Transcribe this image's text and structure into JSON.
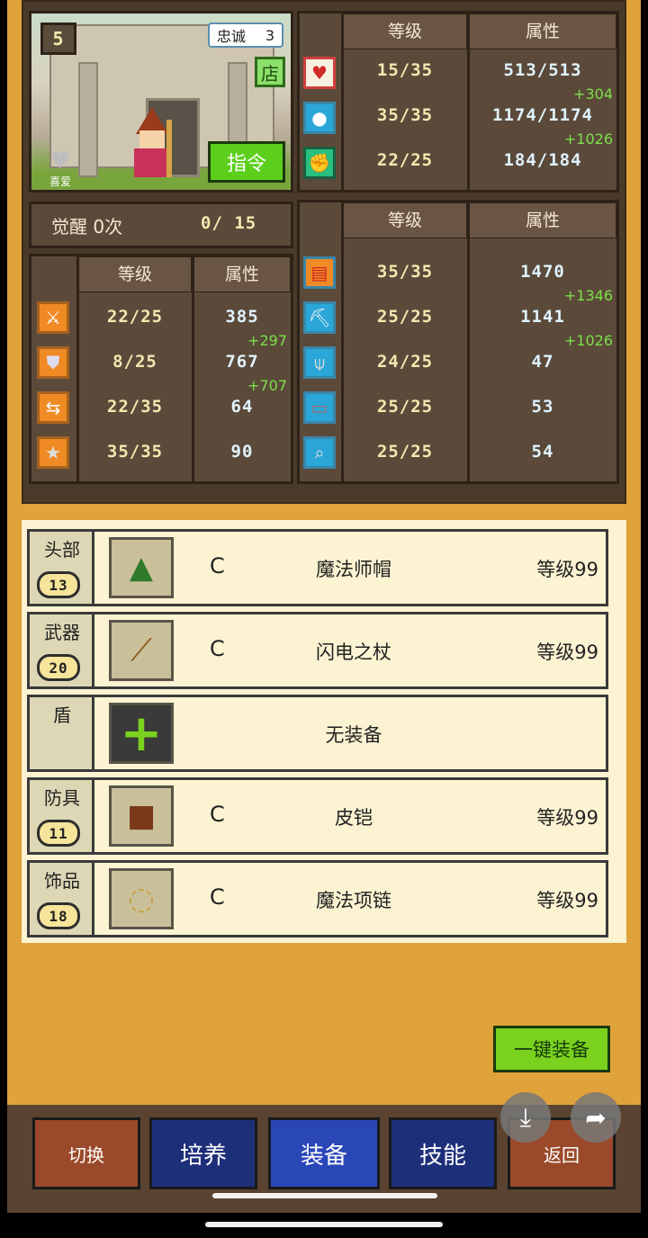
{
  "portrait": {
    "rank_badge": "5",
    "loyalty_label": "忠诚",
    "loyalty_value": "3",
    "shop_label": "店",
    "command_label": "指令",
    "favorite_label": "喜爱"
  },
  "awaken": {
    "label": "觉醒 0次",
    "progress": "0/  15"
  },
  "top_stats": {
    "header_level": "等级",
    "header_attr": "属性",
    "rows": [
      {
        "icon": "heart-icon",
        "level": "15/35",
        "attr": "513/513",
        "bonus": "+304"
      },
      {
        "icon": "mana-potion-icon",
        "level": "35/35",
        "attr": "1174/1174",
        "bonus": "+1026"
      },
      {
        "icon": "strength-arm-icon",
        "level": "22/25",
        "attr": "184/184",
        "bonus": ""
      }
    ]
  },
  "left_stats": {
    "header_level": "等级",
    "header_attr": "属性",
    "rows": [
      {
        "icon": "sword-icon",
        "level": "22/25",
        "attr": "385",
        "bonus": "+297"
      },
      {
        "icon": "shield-icon",
        "level": "8/25",
        "attr": "767",
        "bonus": "+707"
      },
      {
        "icon": "agility-icon",
        "level": "22/35",
        "attr": "64",
        "bonus": ""
      },
      {
        "icon": "star-icon",
        "level": "35/35",
        "attr": "90",
        "bonus": ""
      }
    ]
  },
  "right_stats": {
    "header_level": "等级",
    "header_attr": "属性",
    "rows": [
      {
        "icon": "book-icon",
        "level": "35/35",
        "attr": "1470",
        "bonus": "+1346"
      },
      {
        "icon": "pickaxe-icon",
        "level": "25/25",
        "attr": "1141",
        "bonus": "+1026"
      },
      {
        "icon": "shovel-icon",
        "level": "24/25",
        "attr": "47",
        "bonus": ""
      },
      {
        "icon": "anvil-icon",
        "level": "25/25",
        "attr": "53",
        "bonus": ""
      },
      {
        "icon": "telescope-icon",
        "level": "25/25",
        "attr": "54",
        "bonus": ""
      }
    ]
  },
  "equipment": [
    {
      "slot": "头部",
      "slot_level": "13",
      "icon": "wizard-hat-icon",
      "grade": "C",
      "name": "魔法师帽",
      "level": "等级99"
    },
    {
      "slot": "武器",
      "slot_level": "20",
      "icon": "lightning-staff-icon",
      "grade": "C",
      "name": "闪电之杖",
      "level": "等级99"
    },
    {
      "slot": "盾",
      "slot_level": "",
      "icon": "plus-icon",
      "grade": "",
      "name": "无装备",
      "level": ""
    },
    {
      "slot": "防具",
      "slot_level": "11",
      "icon": "leather-armor-icon",
      "grade": "C",
      "name": "皮铠",
      "level": "等级99"
    },
    {
      "slot": "饰品",
      "slot_level": "18",
      "icon": "necklace-icon",
      "grade": "C",
      "name": "魔法项链",
      "level": "等级99"
    }
  ],
  "auto_equip_label": "一键装备",
  "nav": {
    "switch": "切换",
    "train": "培养",
    "equip": "装备",
    "skill": "技能",
    "back": "返回"
  },
  "colors": {
    "frame": "#e0a23a",
    "panel": "#5b4a3a",
    "bonus_green": "#7ce04a",
    "active_tab": "#2a47b8"
  }
}
